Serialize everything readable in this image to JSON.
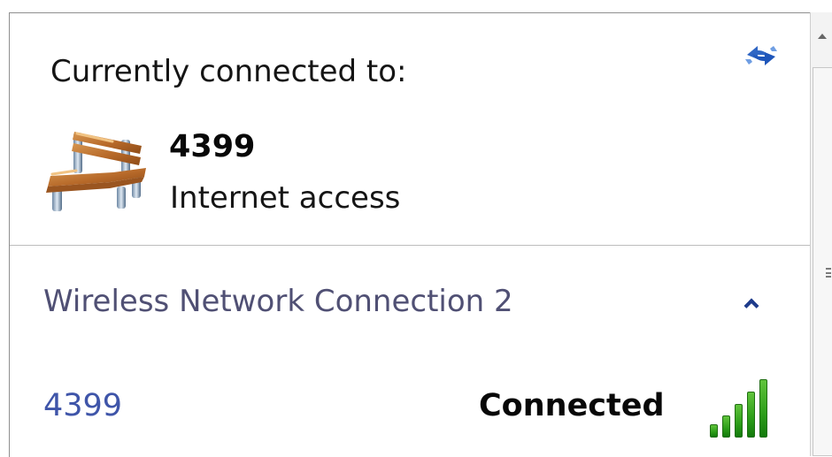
{
  "window": {
    "current_label": "Currently connected to:"
  },
  "current_network": {
    "name": "4399",
    "access": "Internet access"
  },
  "wireless_section": {
    "title": "Wireless Network Connection 2"
  },
  "network_list": [
    {
      "ssid": "4399",
      "status": "Connected"
    }
  ],
  "signal": {
    "level": 1.0
  },
  "icons": {
    "refresh": "refresh-icon",
    "network": "bench-network-icon",
    "collapse": "chevron-up-icon",
    "signal": "signal-strength-icon"
  },
  "colors": {
    "accent_blue": "#3f55a9",
    "section_text": "#505074",
    "signal_green": "#2b9d18"
  }
}
